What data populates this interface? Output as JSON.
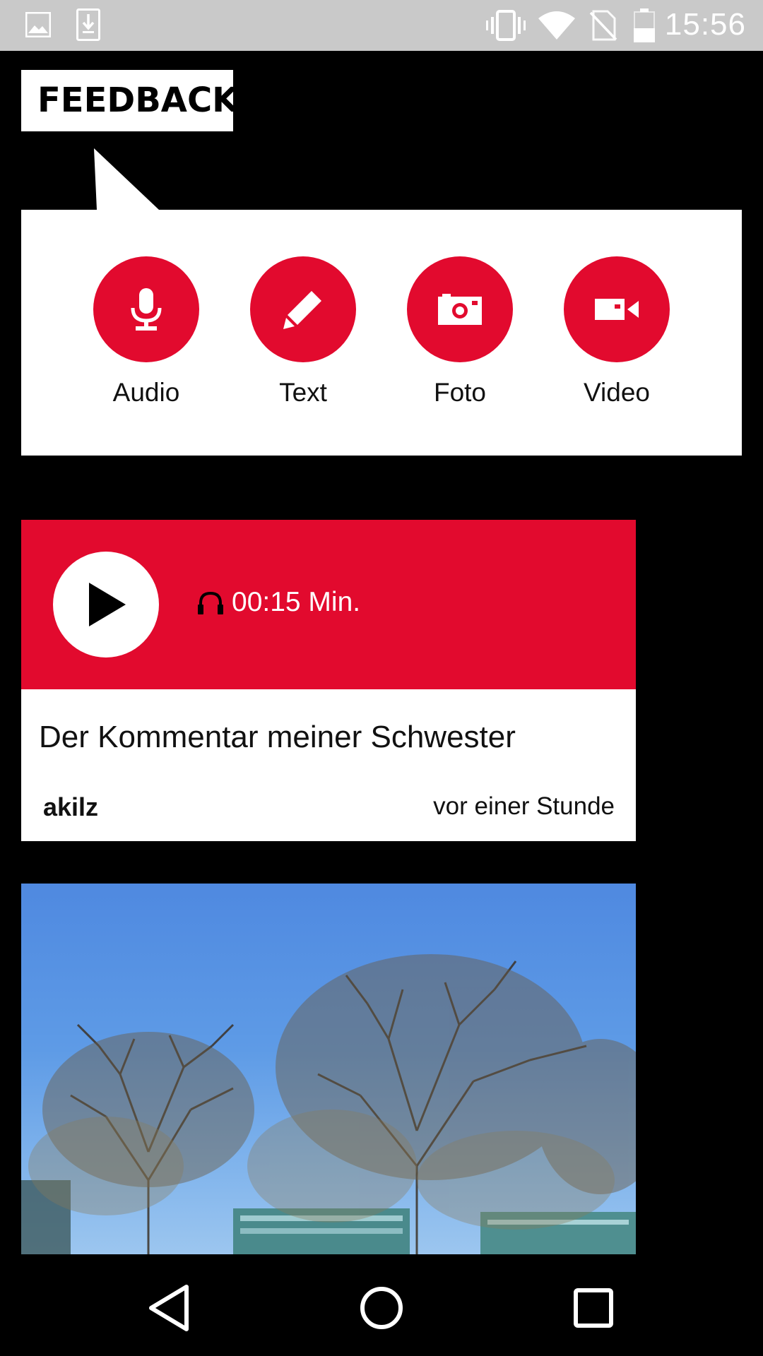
{
  "status_bar": {
    "time": "15:56",
    "icons": [
      "image-icon",
      "download-icon",
      "vibrate-icon",
      "wifi-icon",
      "no-sim-icon",
      "battery-icon"
    ]
  },
  "feedback": {
    "title": "FEEDBACK",
    "buttons": [
      {
        "label": "Audio",
        "icon": "microphone-icon"
      },
      {
        "label": "Text",
        "icon": "pencil-icon"
      },
      {
        "label": "Foto",
        "icon": "camera-icon"
      },
      {
        "label": "Video",
        "icon": "video-camera-icon"
      }
    ],
    "accent_color": "#e20a2e"
  },
  "audio_post": {
    "duration": "00:15 Min.",
    "title": "Der Kommentar meiner Schwester",
    "author": "akilz",
    "posted": "vor einer Stunde"
  },
  "photo_post": {
    "image": "photo of bare trees against a blue sky with buildings"
  },
  "nav_bar": {
    "buttons": [
      "back-icon",
      "home-icon",
      "recents-icon"
    ]
  }
}
